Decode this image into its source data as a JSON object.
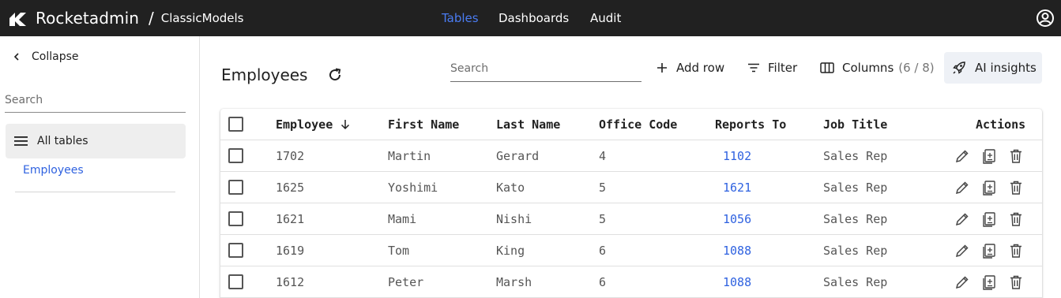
{
  "header": {
    "brand": "Rocketadmin",
    "separator": "/",
    "database": "ClassicModels",
    "nav": {
      "tables": "Tables",
      "dashboards": "Dashboards",
      "audit": "Audit"
    },
    "active_nav": "Tables",
    "accent_color": "#4a7cf2"
  },
  "sidebar": {
    "collapse_label": "Collapse",
    "search_placeholder": "Search",
    "all_tables_label": "All tables",
    "tables": [
      "Employees"
    ]
  },
  "main": {
    "title": "Employees",
    "search_placeholder": "Search",
    "toolbar": {
      "add_row": "Add row",
      "filter": "Filter",
      "columns": "Columns",
      "columns_count": "(6 / 8)",
      "ai_insights": "AI insights"
    }
  },
  "table": {
    "columns": {
      "employee": "Employee",
      "first_name": "First Name",
      "last_name": "Last Name",
      "office_code": "Office Code",
      "reports_to": "Reports To",
      "job_title": "Job Title",
      "actions": "Actions"
    },
    "sort": {
      "column": "Employee",
      "direction": "desc"
    },
    "rows": [
      {
        "employee": "1702",
        "first_name": "Martin",
        "last_name": "Gerard",
        "office_code": "4",
        "reports_to": "1102",
        "job_title": "Sales Rep"
      },
      {
        "employee": "1625",
        "first_name": "Yoshimi",
        "last_name": "Kato",
        "office_code": "5",
        "reports_to": "1621",
        "job_title": "Sales Rep"
      },
      {
        "employee": "1621",
        "first_name": "Mami",
        "last_name": "Nishi",
        "office_code": "5",
        "reports_to": "1056",
        "job_title": "Sales Rep"
      },
      {
        "employee": "1619",
        "first_name": "Tom",
        "last_name": "King",
        "office_code": "6",
        "reports_to": "1088",
        "job_title": "Sales Rep"
      },
      {
        "employee": "1612",
        "first_name": "Peter",
        "last_name": "Marsh",
        "office_code": "6",
        "reports_to": "1088",
        "job_title": "Sales Rep"
      }
    ],
    "row_actions": [
      "edit-icon",
      "duplicate-icon",
      "delete-icon"
    ]
  }
}
